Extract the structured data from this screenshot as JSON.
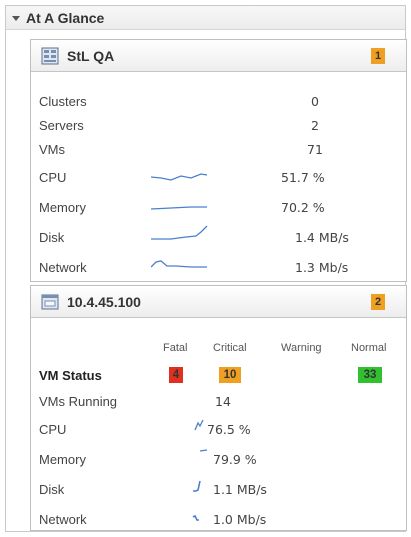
{
  "section": {
    "title": "At A Glance"
  },
  "cluster_panel": {
    "name": "StL QA",
    "badge": "1",
    "rows": [
      {
        "label": "Clusters",
        "value": "0"
      },
      {
        "label": "Servers",
        "value": "2"
      },
      {
        "label": "VMs",
        "value": "71"
      },
      {
        "label": "CPU",
        "value": "51.7  %"
      },
      {
        "label": "Memory",
        "value": "70.2  %"
      },
      {
        "label": "Disk",
        "value": "1.4  MB/s"
      },
      {
        "label": "Network",
        "value": "1.3  Mb/s"
      }
    ]
  },
  "host_panel": {
    "name": "10.4.45.100",
    "badge": "2",
    "status_headers": {
      "fatal": "Fatal",
      "critical": "Critical",
      "warning": "Warning",
      "normal": "Normal"
    },
    "vm_status": {
      "label": "VM Status",
      "fatal": "4",
      "critical": "10",
      "warning": "",
      "normal": "33"
    },
    "rows": [
      {
        "label": "VMs Running",
        "value": "14"
      },
      {
        "label": "CPU",
        "value": "76.5  %"
      },
      {
        "label": "Memory",
        "value": "79.9  %"
      },
      {
        "label": "Disk",
        "value": "1.1  MB/s"
      },
      {
        "label": "Network",
        "value": "1.0  Mb/s"
      }
    ]
  },
  "colors": {
    "badge": "#f0a020",
    "fatal": "#e03020",
    "critical": "#f0a020",
    "normal": "#30c030",
    "sparkline": "#4a7fcf"
  }
}
